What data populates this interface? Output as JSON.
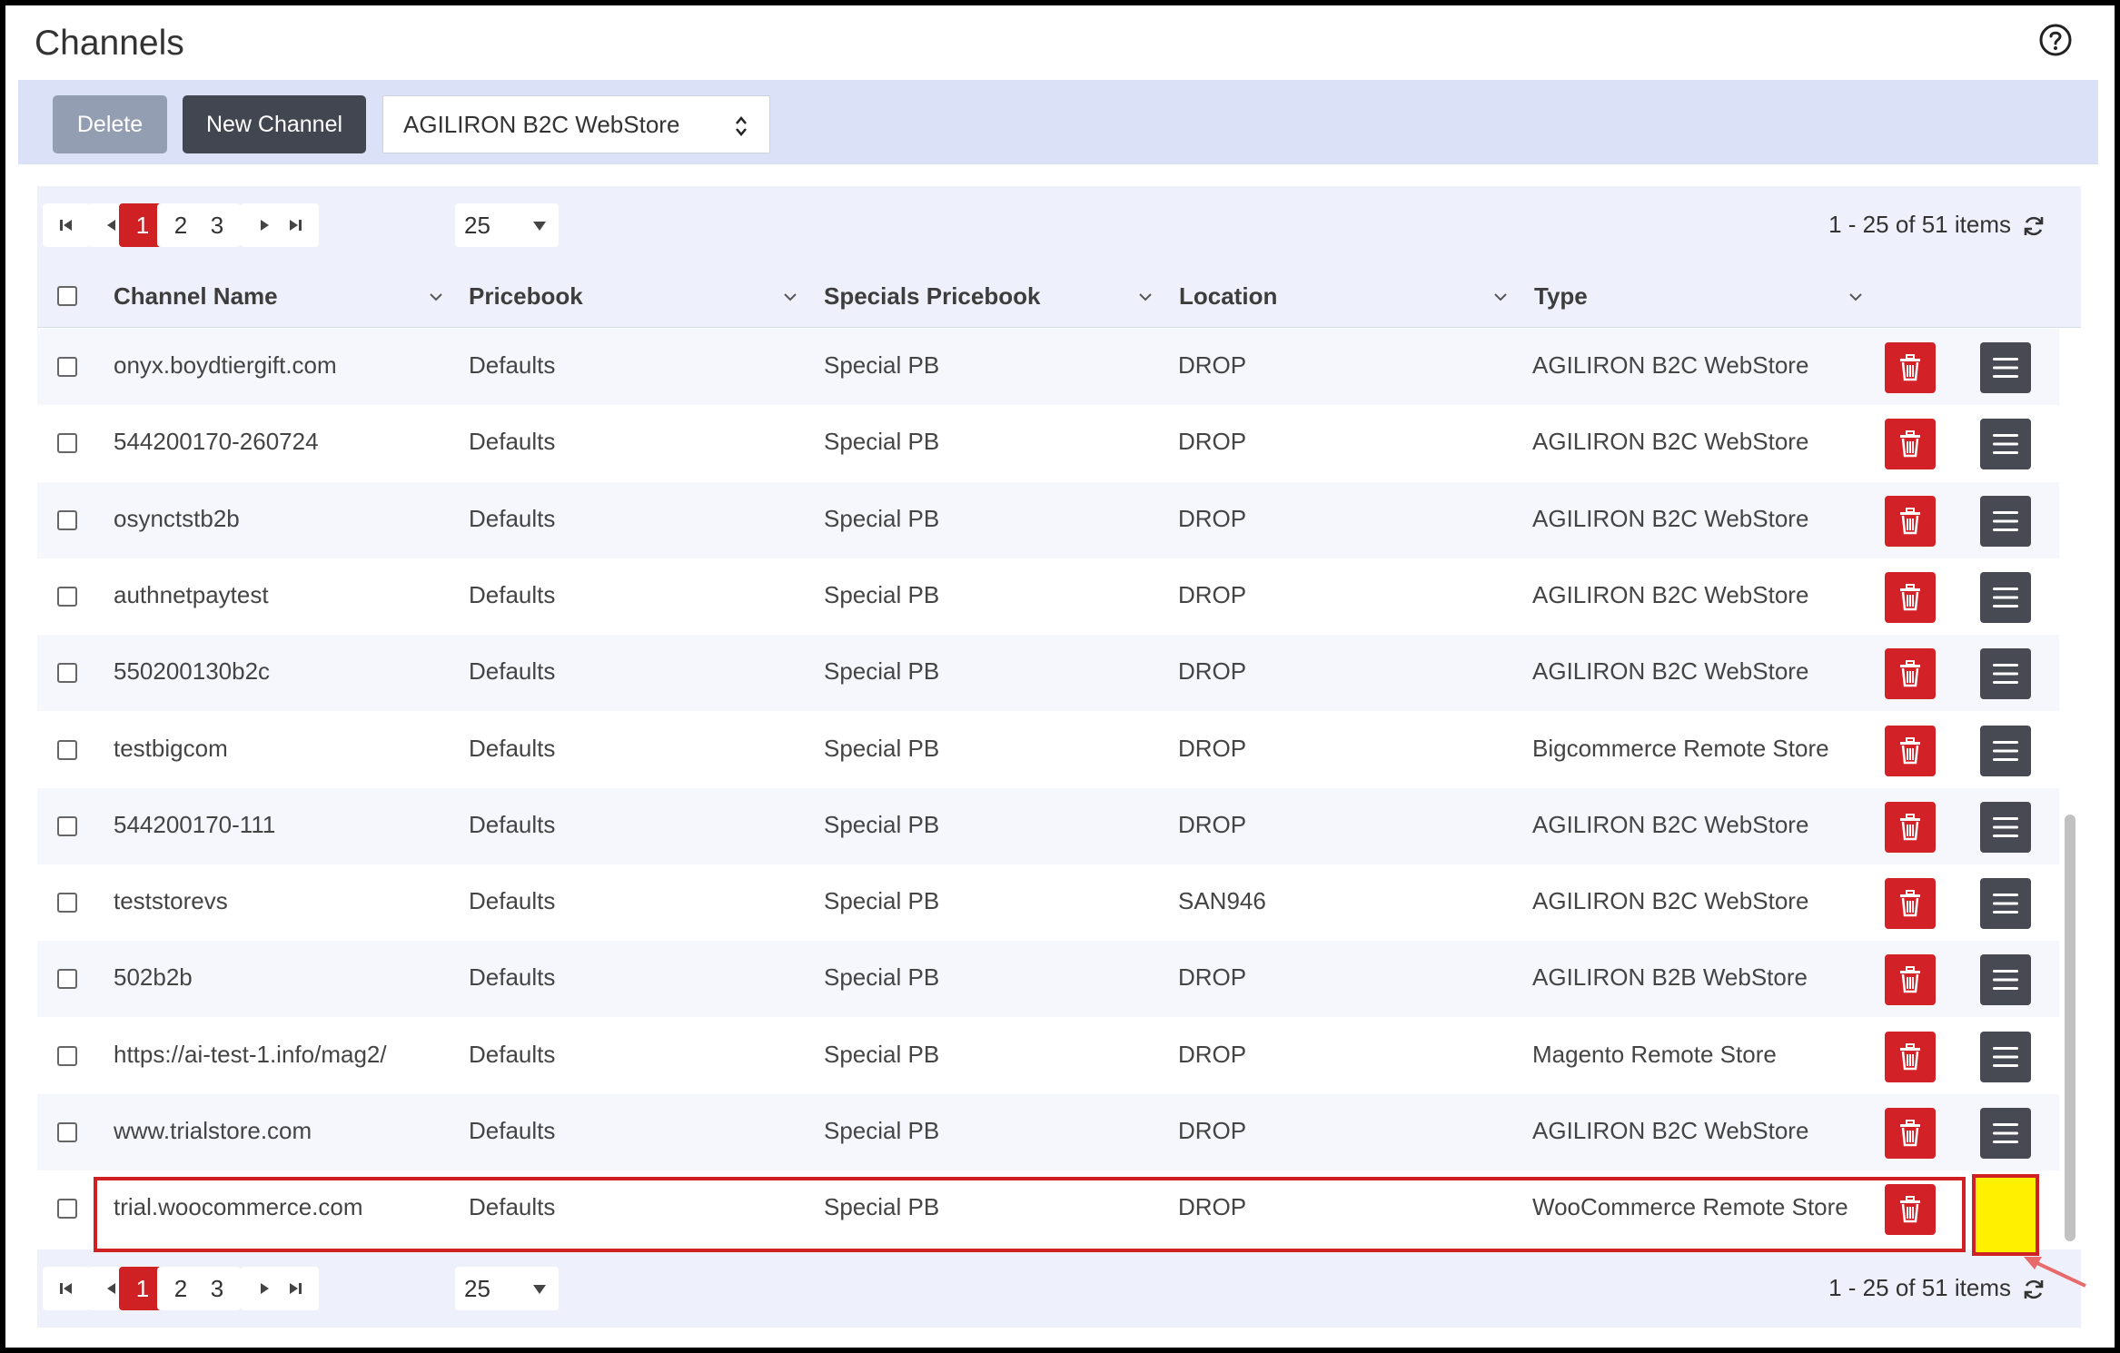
{
  "page": {
    "title": "Channels"
  },
  "toolbar": {
    "delete_label": "Delete",
    "new_channel_label": "New Channel",
    "channel_type_selected": "AGILIRON B2C WebStore"
  },
  "pager": {
    "pages": [
      "1",
      "2",
      "3"
    ],
    "current_page": "1",
    "page_size": "25",
    "info": "1 - 25 of 51 items"
  },
  "columns": {
    "name": "Channel Name",
    "pricebook": "Pricebook",
    "specials": "Specials Pricebook",
    "location": "Location",
    "type": "Type"
  },
  "rows": [
    {
      "name": "onyx.boydtiergift.com",
      "pricebook": "Defaults",
      "specials": "Special PB",
      "location": "DROP",
      "type": "AGILIRON B2C WebStore"
    },
    {
      "name": "544200170-260724",
      "pricebook": "Defaults",
      "specials": "Special PB",
      "location": "DROP",
      "type": "AGILIRON B2C WebStore"
    },
    {
      "name": "osynctstb2b",
      "pricebook": "Defaults",
      "specials": "Special PB",
      "location": "DROP",
      "type": "AGILIRON B2C WebStore"
    },
    {
      "name": "authnetpaytest",
      "pricebook": "Defaults",
      "specials": "Special PB",
      "location": "DROP",
      "type": "AGILIRON B2C WebStore"
    },
    {
      "name": "550200130b2c",
      "pricebook": "Defaults",
      "specials": "Special PB",
      "location": "DROP",
      "type": "AGILIRON B2C WebStore"
    },
    {
      "name": "testbigcom",
      "pricebook": "Defaults",
      "specials": "Special PB",
      "location": "DROP",
      "type": "Bigcommerce Remote Store"
    },
    {
      "name": "544200170-111",
      "pricebook": "Defaults",
      "specials": "Special PB",
      "location": "DROP",
      "type": "AGILIRON B2C WebStore"
    },
    {
      "name": "teststorevs",
      "pricebook": "Defaults",
      "specials": "Special PB",
      "location": "SAN946",
      "type": "AGILIRON B2C WebStore"
    },
    {
      "name": "502b2b",
      "pricebook": "Defaults",
      "specials": "Special PB",
      "location": "DROP",
      "type": "AGILIRON B2B WebStore"
    },
    {
      "name": "https://ai-test-1.info/mag2/",
      "pricebook": "Defaults",
      "specials": "Special PB",
      "location": "DROP",
      "type": "Magento Remote Store"
    },
    {
      "name": "www.trialstore.com",
      "pricebook": "Defaults",
      "specials": "Special PB",
      "location": "DROP",
      "type": "AGILIRON B2C WebStore"
    },
    {
      "name": "trial.woocommerce.com",
      "pricebook": "Defaults",
      "specials": "Special PB",
      "location": "DROP",
      "type": "WooCommerce Remote Store"
    }
  ],
  "colors": {
    "accent_red": "#cf2024",
    "toolbar_bg": "#dbe1f7",
    "highlight_yellow": "#fff000"
  }
}
